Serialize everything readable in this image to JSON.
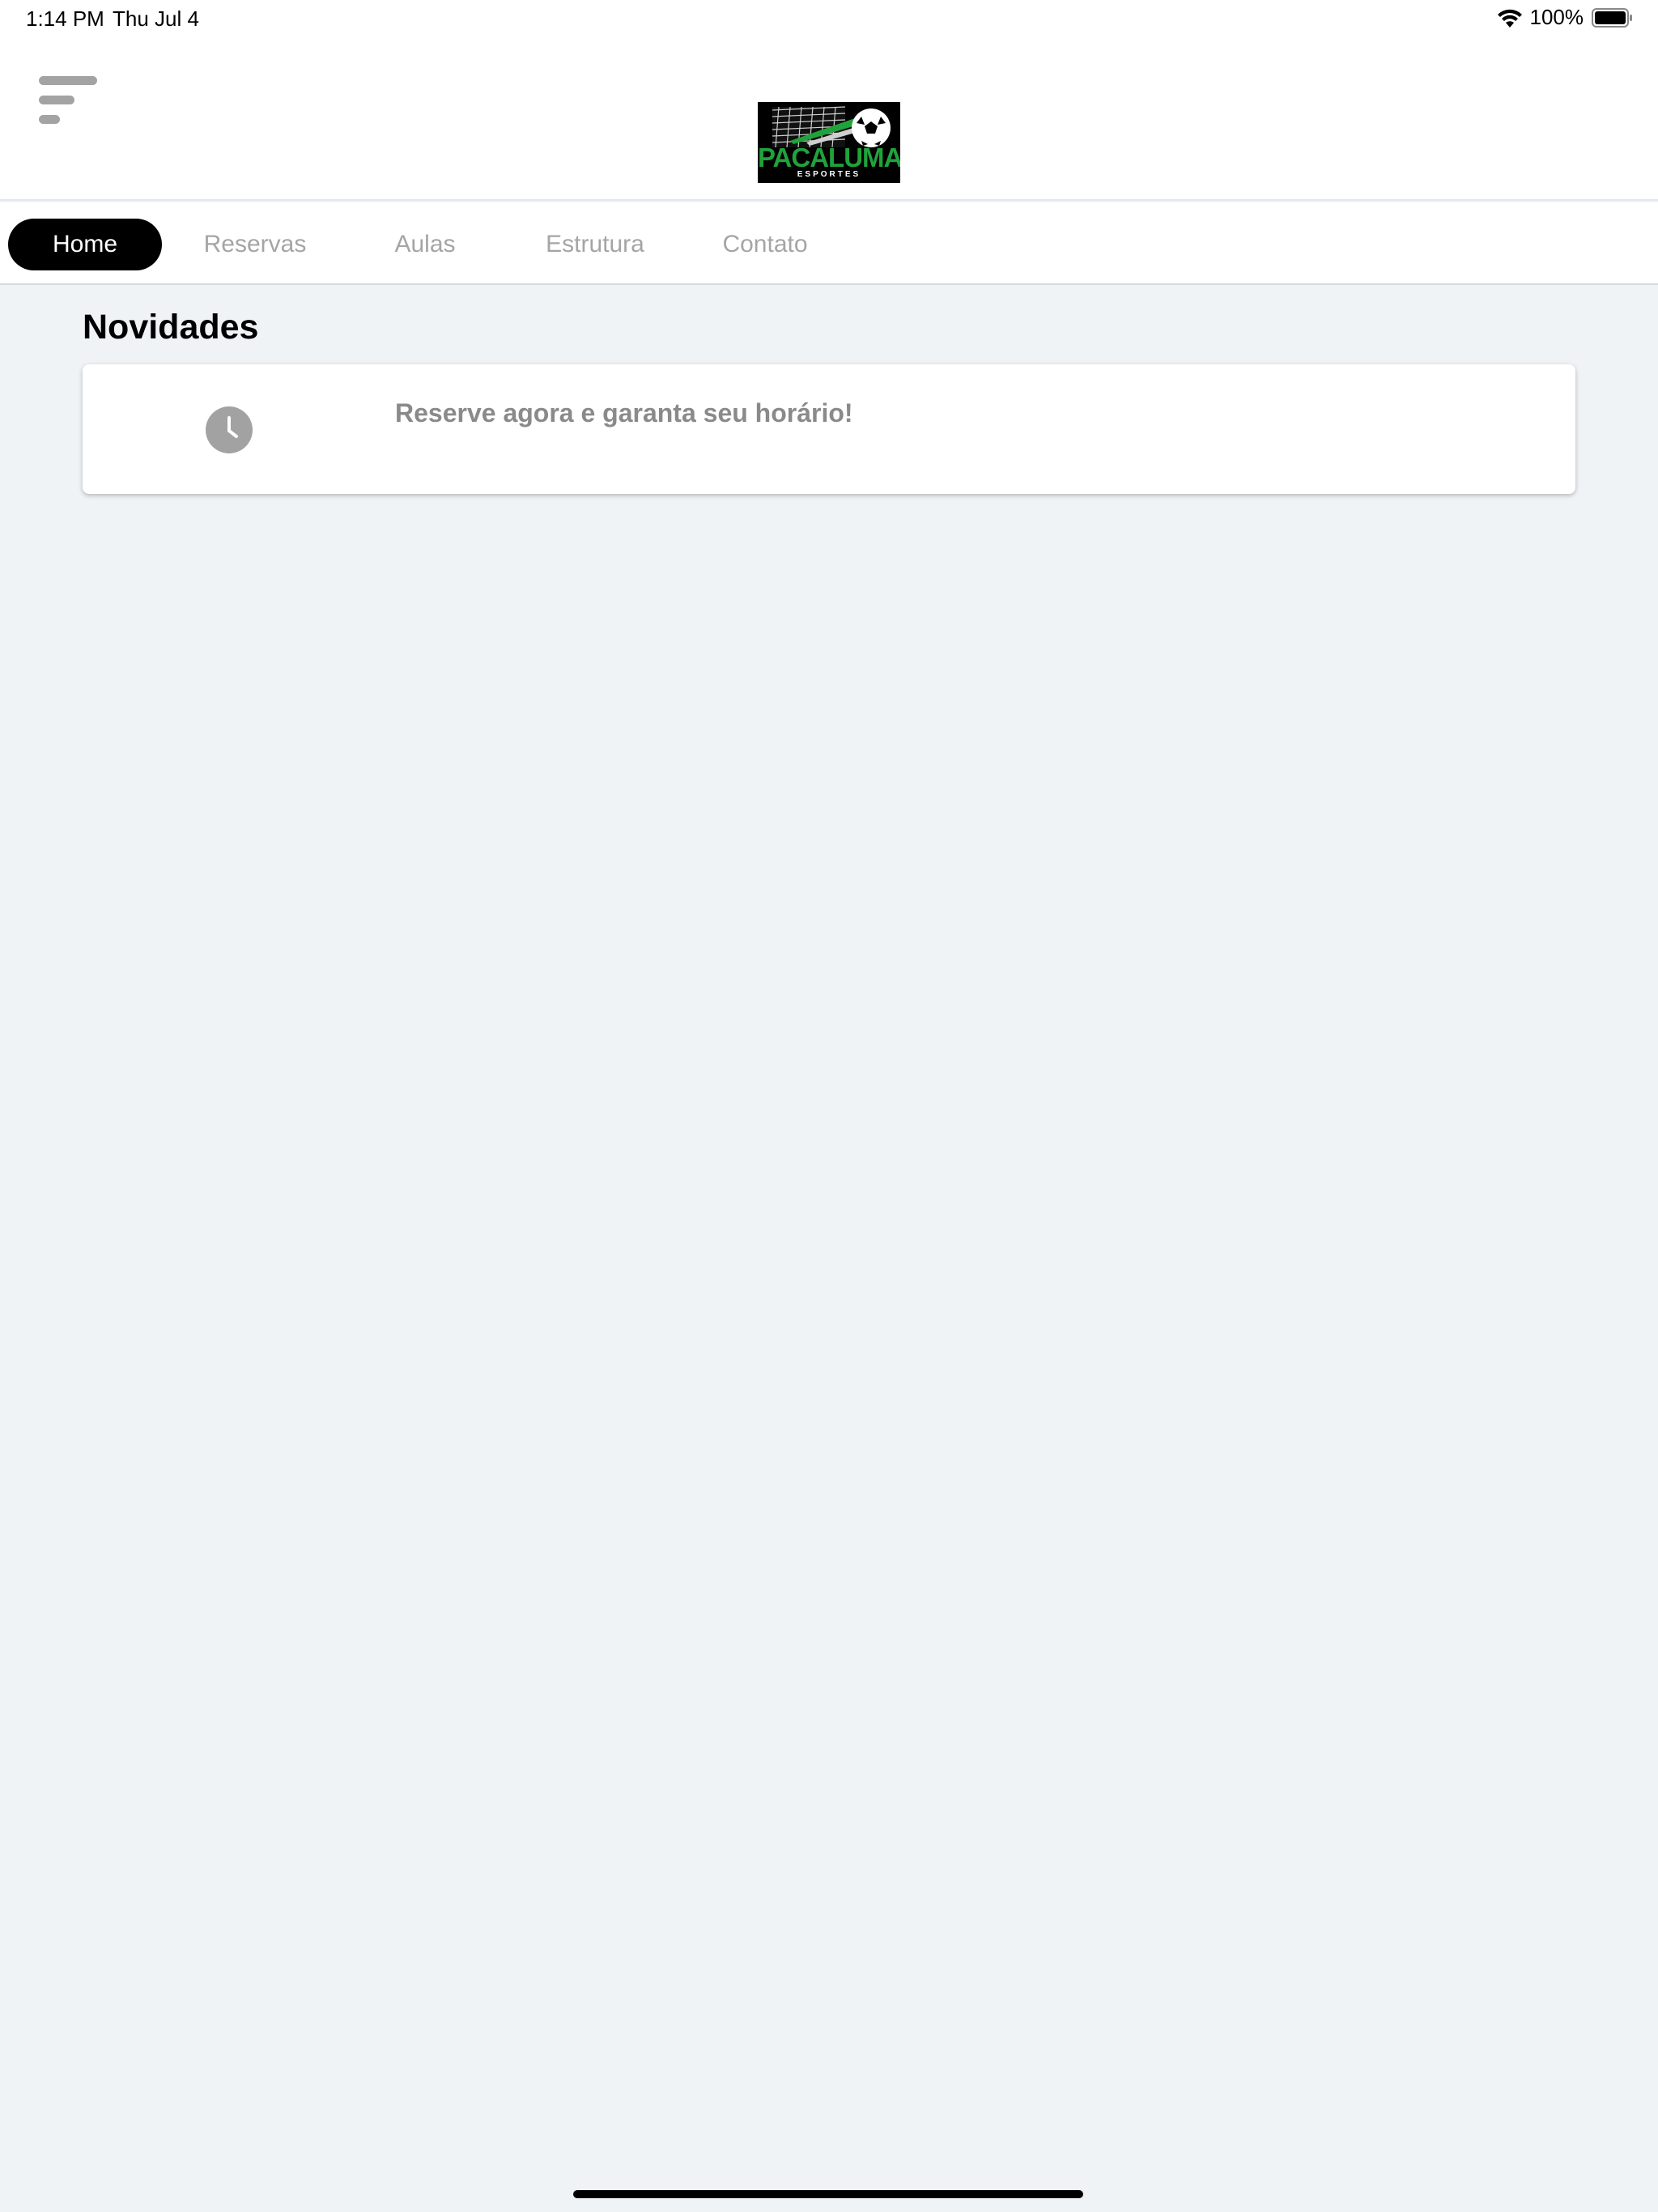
{
  "status_bar": {
    "time": "1:14 PM",
    "date": "Thu Jul 4",
    "battery": "100%"
  },
  "header": {
    "logo_text": "PACALUMA",
    "logo_subtext": "ESPORTES",
    "menu_icon": "hamburger-menu-icon"
  },
  "nav": {
    "tabs": [
      {
        "label": "Home",
        "active": true
      },
      {
        "label": "Reservas",
        "active": false
      },
      {
        "label": "Aulas",
        "active": false
      },
      {
        "label": "Estrutura",
        "active": false
      },
      {
        "label": "Contato",
        "active": false
      }
    ]
  },
  "main": {
    "section_title": "Novidades",
    "news": [
      {
        "icon": "clock-icon",
        "text": "Reserve agora e garanta seu horário!"
      }
    ]
  },
  "colors": {
    "background": "#f0f3f6",
    "active_tab": "#000000",
    "inactive_tab_text": "#a5a5a5",
    "logo_green": "#1fa33a"
  }
}
